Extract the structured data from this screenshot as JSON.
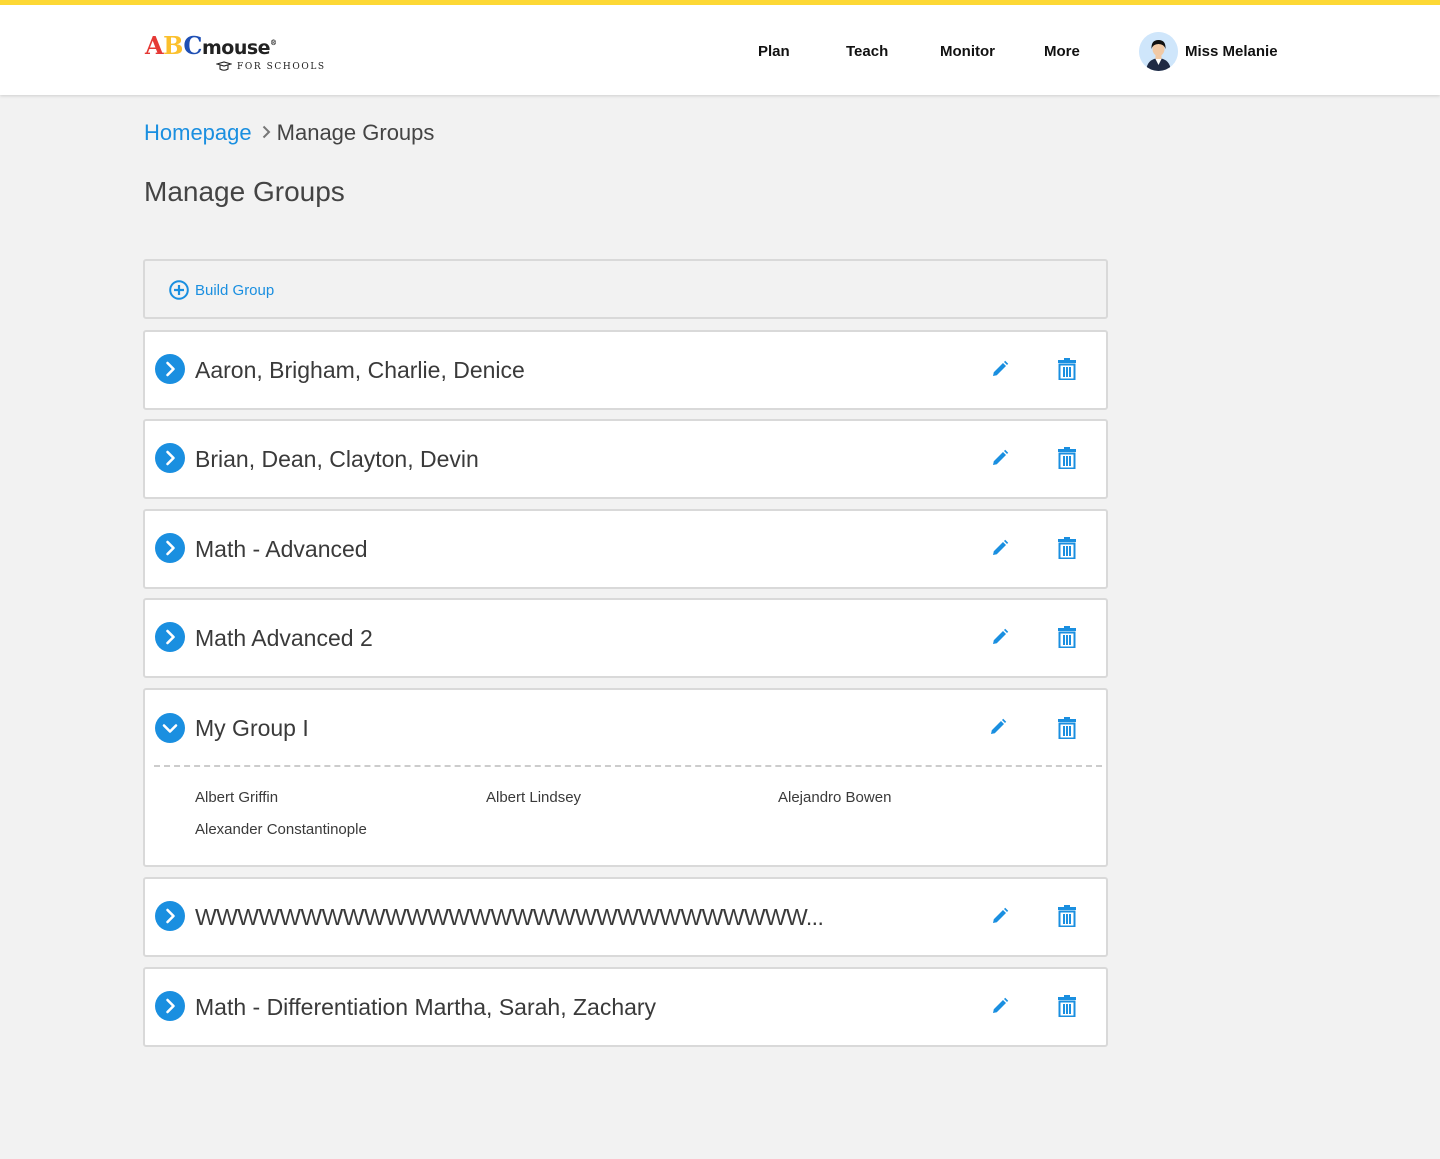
{
  "header": {
    "logo": {
      "a": "A",
      "b": "B",
      "c": "C",
      "mouse": "mouse",
      "reg": "®",
      "sub": "FOR SCHOOLS"
    },
    "nav": {
      "plan": "Plan",
      "teach": "Teach",
      "monitor": "Monitor",
      "more": "More"
    },
    "user": {
      "name": "Miss Melanie"
    }
  },
  "breadcrumb": {
    "home": "Homepage",
    "current": "Manage Groups"
  },
  "page": {
    "title": "Manage Groups"
  },
  "build_group": {
    "label": "Build Group"
  },
  "groups": [
    {
      "name": "Aaron, Brigham, Charlie, Denice",
      "expanded": false
    },
    {
      "name": "Brian, Dean, Clayton, Devin",
      "expanded": false
    },
    {
      "name": "Math - Advanced",
      "expanded": false
    },
    {
      "name": "Math Advanced 2",
      "expanded": false
    },
    {
      "name": "My Group I",
      "expanded": true,
      "members": [
        "Albert Griffin",
        "Albert Lindsey",
        "Alejandro Bowen",
        "Alexander Constantinople"
      ]
    },
    {
      "name": "WWWWWWWWWWWWWWWWWWWWWWWWWWWWW...",
      "expanded": false
    },
    {
      "name": "Math - Differentiation Martha, Sarah, Zachary",
      "expanded": false
    }
  ],
  "colors": {
    "accent": "#1a8fe0",
    "topbar_stripe": "#fdd835",
    "background": "#f2f2f2"
  },
  "icons": {
    "toggle_collapsed": "chevron-right-circle-icon",
    "toggle_expanded": "chevron-down-circle-icon",
    "edit": "pencil-icon",
    "delete": "trash-icon",
    "build": "plus-circle-icon"
  }
}
